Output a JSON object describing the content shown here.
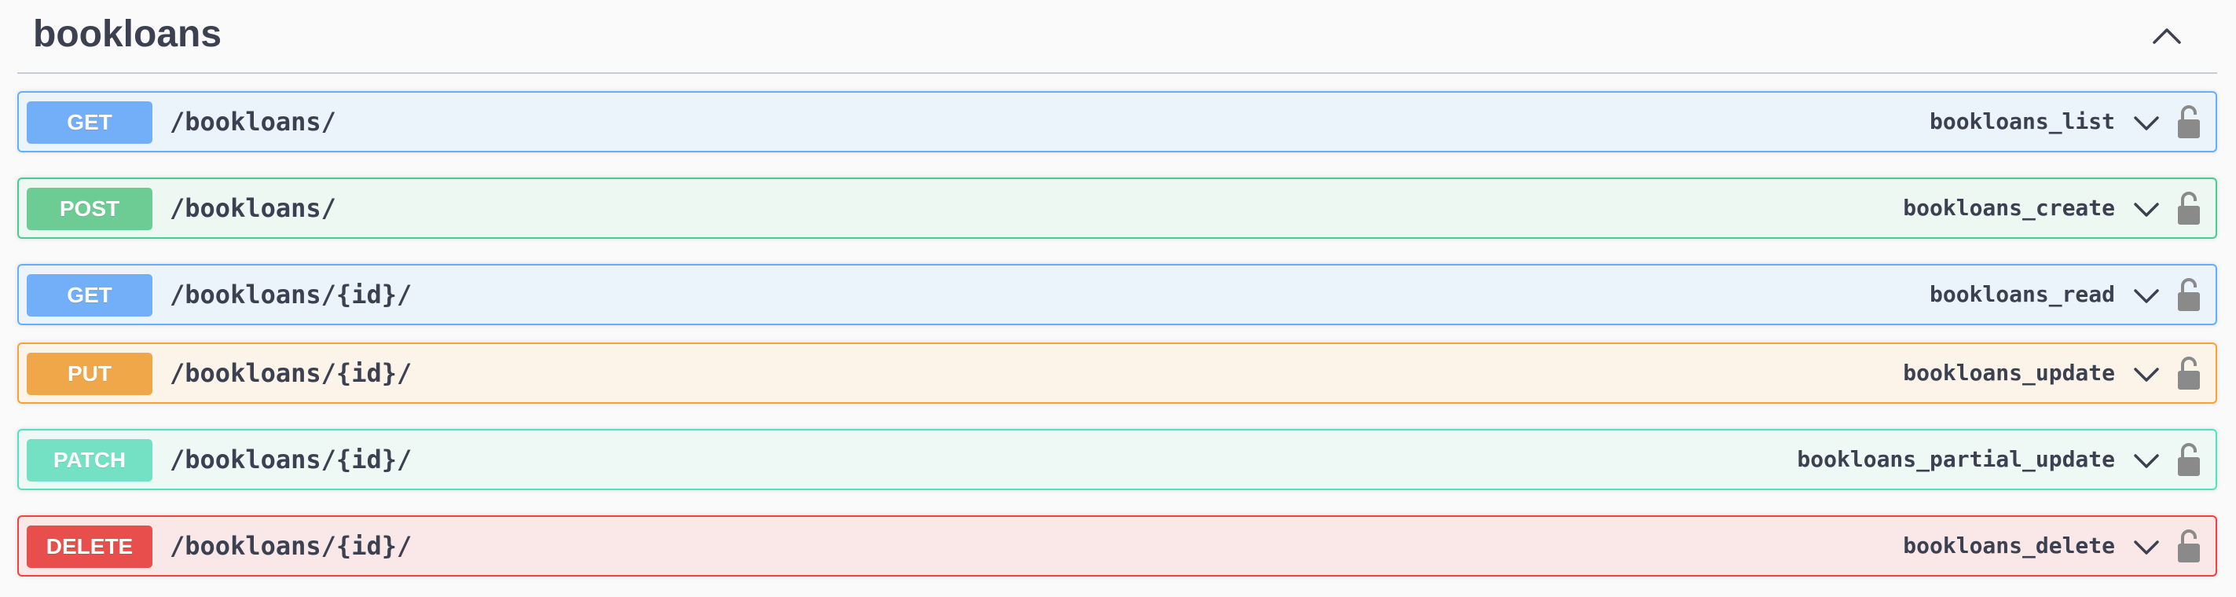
{
  "section": {
    "title": "bookloans"
  },
  "operations": [
    {
      "method": "GET",
      "path": "/bookloans/",
      "summary": "bookloans_list"
    },
    {
      "method": "POST",
      "path": "/bookloans/",
      "summary": "bookloans_create"
    },
    {
      "method": "GET",
      "path": "/bookloans/{id}/",
      "summary": "bookloans_read"
    },
    {
      "method": "PUT",
      "path": "/bookloans/{id}/",
      "summary": "bookloans_update"
    },
    {
      "method": "PATCH",
      "path": "/bookloans/{id}/",
      "summary": "bookloans_partial_update"
    },
    {
      "method": "DELETE",
      "path": "/bookloans/{id}/",
      "summary": "bookloans_delete"
    }
  ],
  "icons": {
    "collapse": "chevron-up-icon",
    "expand": "chevron-down-icon",
    "auth": "lock-icon"
  },
  "colors": {
    "get": "#61affe",
    "post": "#49cc90",
    "put": "#fca130",
    "patch": "#50e3c2",
    "delete": "#f93e3e",
    "text": "#3b4151"
  }
}
